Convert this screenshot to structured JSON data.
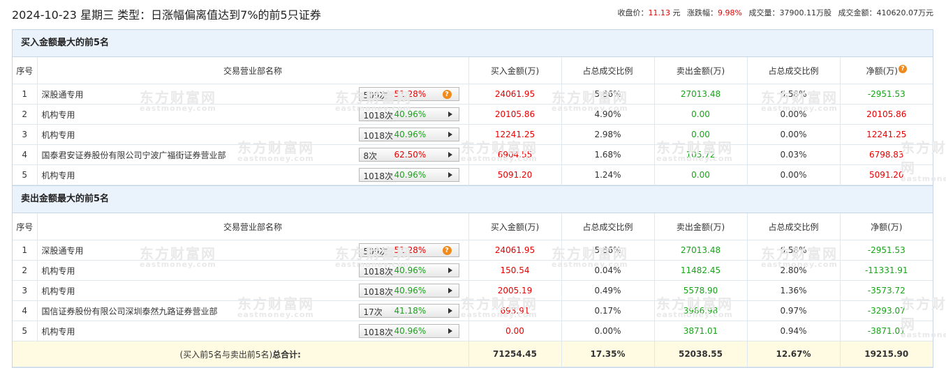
{
  "header": {
    "title": "2024-10-23 星期三 类型：日涨幅偏离值达到7%的前5只证券",
    "close_label": "收盘价：",
    "close_value": "11.13",
    "close_unit": "元",
    "change_label": "涨跌幅：",
    "change_value": "9.98%",
    "volume_label": "成交量：",
    "volume_value": "37900.11万股",
    "turnover_label": "成交金额：",
    "turnover_value": "410620.07万元"
  },
  "columns": {
    "idx": "序号",
    "seat": "交易营业部名称",
    "buy": "买入金额(万)",
    "buy_ratio": "占总成交比例",
    "sell": "卖出金额(万)",
    "sell_ratio": "占总成交比例",
    "net": "净额(万)"
  },
  "help_icon_glyph": "?",
  "watermark": {
    "cn": "东方财富网",
    "en": "eastmoney.com"
  },
  "buy_section": {
    "title": "买入金额最大的前5名",
    "rows": [
      {
        "idx": "1",
        "seat": "深股通专用",
        "count": "509次",
        "rate": "51.28%",
        "rate_color": "red",
        "icon": "help",
        "buy": "24061.95",
        "buy_ratio": "5.86%",
        "sell": "27013.48",
        "sell_ratio": "6.58%",
        "net": "-2951.53",
        "net_color": "green"
      },
      {
        "idx": "2",
        "seat": "机构专用",
        "count": "1018次",
        "rate": "40.96%",
        "rate_color": "green",
        "icon": "arrow",
        "buy": "20105.86",
        "buy_ratio": "4.90%",
        "sell": "0.00",
        "sell_ratio": "0.00%",
        "net": "20105.86",
        "net_color": "red"
      },
      {
        "idx": "3",
        "seat": "机构专用",
        "count": "1018次",
        "rate": "40.96%",
        "rate_color": "green",
        "icon": "arrow",
        "buy": "12241.25",
        "buy_ratio": "2.98%",
        "sell": "0.00",
        "sell_ratio": "0.00%",
        "net": "12241.25",
        "net_color": "red"
      },
      {
        "idx": "4",
        "seat": "国泰君安证券股份有限公司宁波广福街证券营业部",
        "count": "8次",
        "rate": "62.50%",
        "rate_color": "red",
        "icon": "arrow",
        "buy": "6904.55",
        "buy_ratio": "1.68%",
        "sell": "105.72",
        "sell_ratio": "0.03%",
        "net": "6798.83",
        "net_color": "red"
      },
      {
        "idx": "5",
        "seat": "机构专用",
        "count": "1018次",
        "rate": "40.96%",
        "rate_color": "green",
        "icon": "arrow",
        "buy": "5091.20",
        "buy_ratio": "1.24%",
        "sell": "0.00",
        "sell_ratio": "0.00%",
        "net": "5091.20",
        "net_color": "red"
      }
    ]
  },
  "sell_section": {
    "title": "卖出金额最大的前5名",
    "rows": [
      {
        "idx": "1",
        "seat": "深股通专用",
        "count": "509次",
        "rate": "51.28%",
        "rate_color": "red",
        "icon": "help",
        "buy": "24061.95",
        "buy_ratio": "5.86%",
        "sell": "27013.48",
        "sell_ratio": "6.58%",
        "net": "-2951.53",
        "net_color": "green"
      },
      {
        "idx": "2",
        "seat": "机构专用",
        "count": "1018次",
        "rate": "40.96%",
        "rate_color": "green",
        "icon": "arrow",
        "buy": "150.54",
        "buy_ratio": "0.04%",
        "sell": "11482.45",
        "sell_ratio": "2.80%",
        "net": "-11331.91",
        "net_color": "green"
      },
      {
        "idx": "3",
        "seat": "机构专用",
        "count": "1018次",
        "rate": "40.96%",
        "rate_color": "green",
        "icon": "arrow",
        "buy": "2005.19",
        "buy_ratio": "0.49%",
        "sell": "5578.90",
        "sell_ratio": "1.36%",
        "net": "-3573.72",
        "net_color": "green"
      },
      {
        "idx": "4",
        "seat": "国信证券股份有限公司深圳泰然九路证券营业部",
        "count": "17次",
        "rate": "41.18%",
        "rate_color": "green",
        "icon": "arrow",
        "buy": "693.91",
        "buy_ratio": "0.17%",
        "sell": "3986.98",
        "sell_ratio": "0.97%",
        "net": "-3293.07",
        "net_color": "green"
      },
      {
        "idx": "5",
        "seat": "机构专用",
        "count": "1018次",
        "rate": "40.96%",
        "rate_color": "green",
        "icon": "arrow",
        "buy": "0.00",
        "buy_ratio": "0.00%",
        "sell": "3871.01",
        "sell_ratio": "0.94%",
        "net": "-3871.01",
        "net_color": "green"
      }
    ],
    "total": {
      "label_prefix": "(买入前5名与卖出前5名)",
      "label_bold": "总合计:",
      "buy": "71254.45",
      "buy_ratio": "17.35%",
      "sell": "52038.55",
      "sell_ratio": "12.67%",
      "net": "19215.90"
    }
  },
  "colors": {
    "red": "#e60000",
    "green": "#19a319",
    "header_bg": "#eaf3fb",
    "total_bg": "#fffbe3",
    "help_icon": "#f08a1c"
  }
}
